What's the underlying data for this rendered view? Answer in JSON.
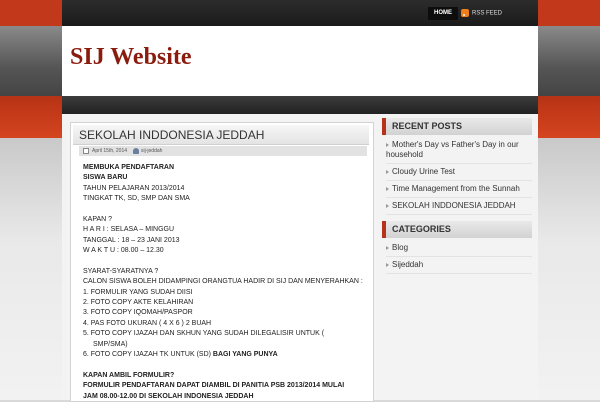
{
  "nav": {
    "home_label": "HOME",
    "rss_label": "RSS FEED"
  },
  "site": {
    "title": "SIJ Website"
  },
  "post": {
    "title": "SEKOLAH INDDONESIA JEDDAH",
    "date": "April 15th, 2014",
    "author": "sij-jeddah",
    "lines": [
      "MEMBUKA  PENDAFTARAN",
      "SISWA BARU",
      "TAHUN PELAJARAN 2013/2014",
      "TINGKAT TK, SD, SMP DAN SMA",
      "KAPAN ?",
      "H A R I   : SELASA – MINGGU",
      "TANGGAL : 18 – 23 JANI 2013",
      "W A K T U : 08.00 – 12.30",
      "SYARAT-SYARATNYA ?",
      "CALON SISWA BOLEH DIDAMPINGI ORANGTUA HADIR DI SIJ DAN MENYERAHKAN :",
      "1.  FORMULIR YANG SUDAH DIISI",
      "2.  FOTO COPY AKTE KELAHIRAN",
      "3.  FOTO COPY IQOMAH/PASPOR",
      "4.  PAS FOTO UKURAN ( 4 X 6 ) 2 BUAH",
      "5.  FOTO COPY IJAZAH DAN SKHUN YANG SUDAH DILEGALISIR UNTUK (",
      "SMP/SMA)",
      "6.  FOTO COPY IJAZAH TK UNTUK  (SD) ",
      "BAGI YANG PUNYA",
      "KAPAN AMBIL FORMULIR?",
      "FORMULIR   PENDAFTARAN   DAPAT DIAMBIL DI PANITIA PSB 2013/2014 MULAI",
      "JAM 08.00-12.00  DI SEKOLAH INDONESIA JEDDAH"
    ]
  },
  "sidebar": {
    "recent_title": "RECENT POSTS",
    "recent": [
      "Mother's Day vs Father's Day in our household",
      "Cloudy Urine Test",
      "Time Management from the Sunnah",
      "SEKOLAH INDDONESIA JEDDAH"
    ],
    "categories_title": "CATEGORIES",
    "categories": [
      "Blog",
      "Sijeddah"
    ]
  }
}
